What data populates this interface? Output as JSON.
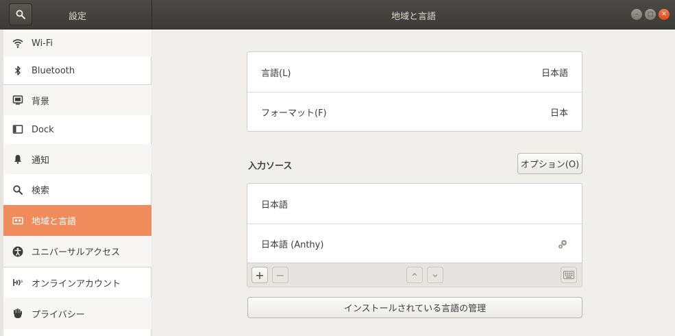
{
  "header": {
    "left_title": "設定",
    "main_title": "地域と言語",
    "search_icon": "search-icon",
    "controls": {
      "minimize": "–",
      "maximize": "□",
      "close": "✕"
    }
  },
  "sidebar": {
    "items": [
      {
        "label": "Wi-Fi",
        "icon": "wifi-icon"
      },
      {
        "label": "Bluetooth",
        "icon": "bluetooth-icon"
      },
      {
        "label": "背景",
        "icon": "background-icon"
      },
      {
        "label": "Dock",
        "icon": "dock-icon"
      },
      {
        "label": "通知",
        "icon": "bell-icon"
      },
      {
        "label": "検索",
        "icon": "search-icon"
      },
      {
        "label": "地域と言語",
        "icon": "region-icon",
        "active": true
      },
      {
        "label": "ユニバーサルアクセス",
        "icon": "accessibility-icon"
      },
      {
        "label": "オンラインアカウント",
        "icon": "online-accounts-icon"
      },
      {
        "label": "プライバシー",
        "icon": "hand-icon"
      }
    ]
  },
  "main": {
    "language": {
      "label": "言語(L)",
      "value": "日本語"
    },
    "format": {
      "label": "フォーマット(F)",
      "value": "日本"
    },
    "input_sources": {
      "title": "入力ソース",
      "options_button": "オプション(O)",
      "items": [
        {
          "label": "日本語"
        },
        {
          "label": "日本語 (Anthy)",
          "has_settings": true
        }
      ],
      "toolbar": {
        "add": "+",
        "remove": "−",
        "up": "⌃",
        "down": "⌄"
      }
    },
    "manage_button": "インストールされている言語の管理"
  },
  "colors": {
    "accent": "#f08b5b",
    "header_bg": "#3c3b37",
    "close": "#de4a1a"
  }
}
